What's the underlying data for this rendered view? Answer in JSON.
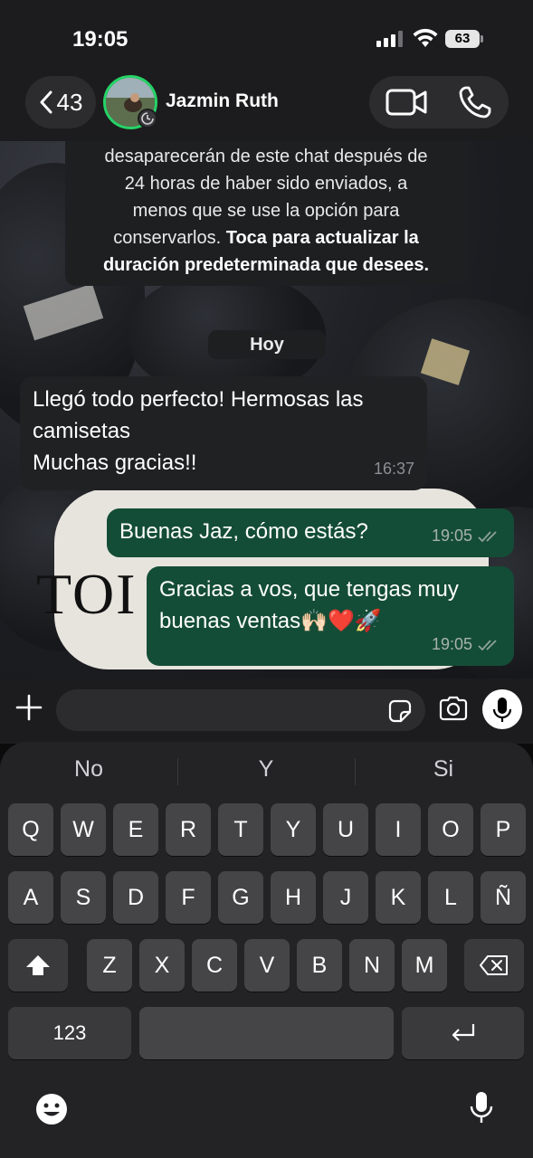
{
  "status_bar": {
    "time": "19:05",
    "battery": "63"
  },
  "header": {
    "back_count": "43",
    "contact_name": "Jazmin Ruth"
  },
  "wallpaper": {
    "paper_text": "TOI"
  },
  "notice": {
    "line1": "desaparecerán de este chat después de",
    "line2": "24 horas de haber sido enviados, a",
    "line3": "menos que se use la opción para",
    "line4_plain": "conservarlos. ",
    "line4_bold": "Toca para actualizar la",
    "line5_bold": "duración predeterminada que desees."
  },
  "date_chip": "Hoy",
  "messages": [
    {
      "direction": "in",
      "lines": [
        "Llegó todo perfecto! Hermosas las",
        "camisetas",
        "Muchas gracias!!"
      ],
      "time": "16:37"
    },
    {
      "direction": "out",
      "lines": [
        "Buenas Jaz, cómo estás?"
      ],
      "time": "19:05",
      "status": "read"
    },
    {
      "direction": "out",
      "lines": [
        "Gracias a vos, que tengas muy",
        "buenas ventas🙌🏻❤️🚀"
      ],
      "time": "19:05",
      "status": "read"
    }
  ],
  "keyboard": {
    "suggestions": [
      "No",
      "Y",
      "Si"
    ],
    "row1": [
      "Q",
      "W",
      "E",
      "R",
      "T",
      "Y",
      "U",
      "I",
      "O",
      "P"
    ],
    "row2": [
      "A",
      "S",
      "D",
      "F",
      "G",
      "H",
      "J",
      "K",
      "L",
      "Ñ"
    ],
    "row3": [
      "Z",
      "X",
      "C",
      "V",
      "B",
      "N",
      "M"
    ],
    "numbers_key": "123"
  },
  "colors": {
    "accent": "#25d366",
    "outgoing_bubble": "#144d37",
    "incoming_bubble": "#1f2123"
  }
}
